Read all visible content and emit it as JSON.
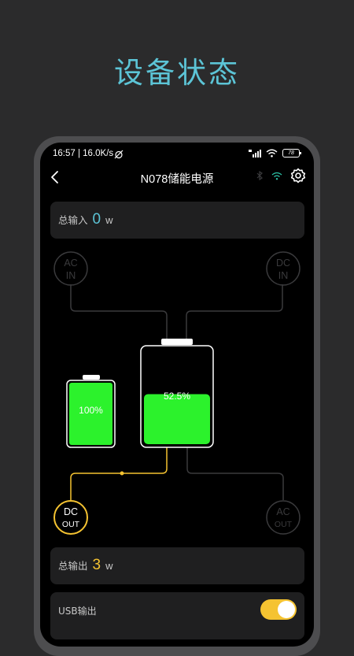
{
  "banner": {
    "title": "设备状态"
  },
  "status_bar": {
    "time": "16:57 | 16.0K/s",
    "battery": "78"
  },
  "header": {
    "title": "N078储能电源"
  },
  "total_input": {
    "label": "总输入",
    "value": "0",
    "unit": "w"
  },
  "total_output": {
    "label": "总输出",
    "value": "3",
    "unit": "w"
  },
  "ports": {
    "ac_in": {
      "line1": "AC",
      "line2": "IN",
      "active": false
    },
    "dc_in": {
      "line1": "DC",
      "line2": "IN",
      "active": false
    },
    "dc_out": {
      "line1": "DC",
      "line2": "OUT",
      "active": true
    },
    "ac_out": {
      "line1": "AC",
      "line2": "OUT",
      "active": false
    }
  },
  "batteries": {
    "small": {
      "percent_label": "100%",
      "level": 1.0
    },
    "main": {
      "percent_label": "52.5%",
      "level": 0.525
    }
  },
  "usb_output": {
    "label": "USB输出",
    "enabled": true
  },
  "colors": {
    "accent_input": "#5cc4d6",
    "accent_output": "#f5c331",
    "battery_fill": "#2cf22c",
    "inactive_line": "#3a3a3c"
  }
}
